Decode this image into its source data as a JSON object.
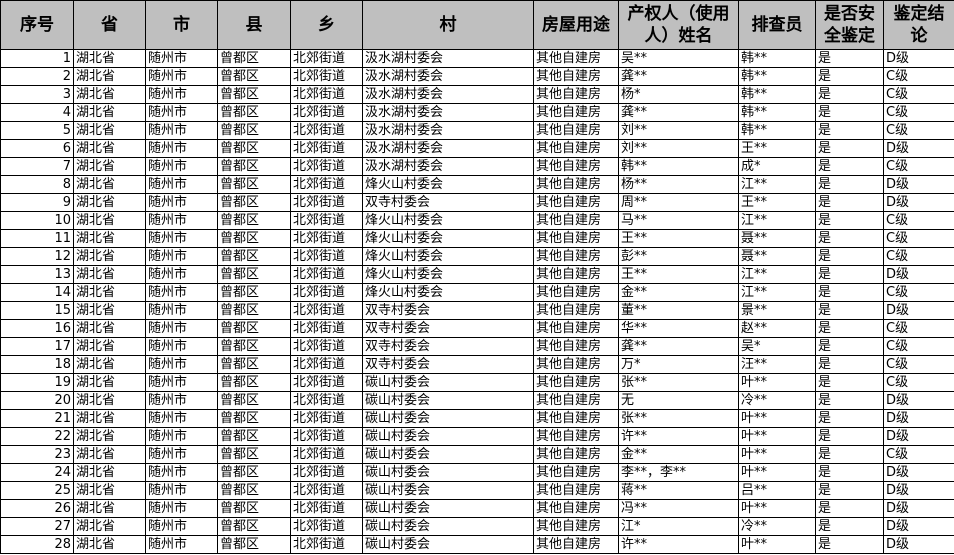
{
  "headers": [
    "序号",
    "省",
    "市",
    "县",
    "乡",
    "村",
    "房屋用途",
    "产权人（使用人）姓名",
    "排查员",
    "是否安全鉴定",
    "鉴定结论"
  ],
  "rows": [
    [
      "1",
      "湖北省",
      "随州市",
      "曾都区",
      "北郊街道",
      "汲水湖村委会",
      "其他自建房",
      "吴**",
      "韩**",
      "是",
      "D级"
    ],
    [
      "2",
      "湖北省",
      "随州市",
      "曾都区",
      "北郊街道",
      "汲水湖村委会",
      "其他自建房",
      "龚**",
      "韩**",
      "是",
      "C级"
    ],
    [
      "3",
      "湖北省",
      "随州市",
      "曾都区",
      "北郊街道",
      "汲水湖村委会",
      "其他自建房",
      "杨*",
      "韩**",
      "是",
      "C级"
    ],
    [
      "4",
      "湖北省",
      "随州市",
      "曾都区",
      "北郊街道",
      "汲水湖村委会",
      "其他自建房",
      "龚**",
      "韩**",
      "是",
      "C级"
    ],
    [
      "5",
      "湖北省",
      "随州市",
      "曾都区",
      "北郊街道",
      "汲水湖村委会",
      "其他自建房",
      "刘**",
      "韩**",
      "是",
      "C级"
    ],
    [
      "6",
      "湖北省",
      "随州市",
      "曾都区",
      "北郊街道",
      "汲水湖村委会",
      "其他自建房",
      "刘**",
      "王**",
      "是",
      "D级"
    ],
    [
      "7",
      "湖北省",
      "随州市",
      "曾都区",
      "北郊街道",
      "汲水湖村委会",
      "其他自建房",
      "韩**",
      "成*",
      "是",
      "C级"
    ],
    [
      "8",
      "湖北省",
      "随州市",
      "曾都区",
      "北郊街道",
      "烽火山村委会",
      "其他自建房",
      "杨**",
      "江**",
      "是",
      "D级"
    ],
    [
      "9",
      "湖北省",
      "随州市",
      "曾都区",
      "北郊街道",
      "双寺村委会",
      "其他自建房",
      "周**",
      "王**",
      "是",
      "D级"
    ],
    [
      "10",
      "湖北省",
      "随州市",
      "曾都区",
      "北郊街道",
      "烽火山村委会",
      "其他自建房",
      "马**",
      "江**",
      "是",
      "C级"
    ],
    [
      "11",
      "湖北省",
      "随州市",
      "曾都区",
      "北郊街道",
      "烽火山村委会",
      "其他自建房",
      "王**",
      "聂**",
      "是",
      "C级"
    ],
    [
      "12",
      "湖北省",
      "随州市",
      "曾都区",
      "北郊街道",
      "烽火山村委会",
      "其他自建房",
      "彭**",
      "聂**",
      "是",
      "C级"
    ],
    [
      "13",
      "湖北省",
      "随州市",
      "曾都区",
      "北郊街道",
      "烽火山村委会",
      "其他自建房",
      "王**",
      "江**",
      "是",
      "D级"
    ],
    [
      "14",
      "湖北省",
      "随州市",
      "曾都区",
      "北郊街道",
      "烽火山村委会",
      "其他自建房",
      "金**",
      "江**",
      "是",
      "C级"
    ],
    [
      "15",
      "湖北省",
      "随州市",
      "曾都区",
      "北郊街道",
      "双寺村委会",
      "其他自建房",
      "董**",
      "景**",
      "是",
      "D级"
    ],
    [
      "16",
      "湖北省",
      "随州市",
      "曾都区",
      "北郊街道",
      "双寺村委会",
      "其他自建房",
      "华**",
      "赵**",
      "是",
      "C级"
    ],
    [
      "17",
      "湖北省",
      "随州市",
      "曾都区",
      "北郊街道",
      "双寺村委会",
      "其他自建房",
      "龚**",
      "吴*",
      "是",
      "C级"
    ],
    [
      "18",
      "湖北省",
      "随州市",
      "曾都区",
      "北郊街道",
      "双寺村委会",
      "其他自建房",
      "万*",
      "汪**",
      "是",
      "C级"
    ],
    [
      "19",
      "湖北省",
      "随州市",
      "曾都区",
      "北郊街道",
      "碳山村委会",
      "其他自建房",
      "张**",
      "叶**",
      "是",
      "C级"
    ],
    [
      "20",
      "湖北省",
      "随州市",
      "曾都区",
      "北郊街道",
      "碳山村委会",
      "其他自建房",
      "无",
      "冷**",
      "是",
      "D级"
    ],
    [
      "21",
      "湖北省",
      "随州市",
      "曾都区",
      "北郊街道",
      "碳山村委会",
      "其他自建房",
      "张**",
      "叶**",
      "是",
      "D级"
    ],
    [
      "22",
      "湖北省",
      "随州市",
      "曾都区",
      "北郊街道",
      "碳山村委会",
      "其他自建房",
      "许**",
      "叶**",
      "是",
      "D级"
    ],
    [
      "23",
      "湖北省",
      "随州市",
      "曾都区",
      "北郊街道",
      "碳山村委会",
      "其他自建房",
      "金**",
      "叶**",
      "是",
      "C级"
    ],
    [
      "24",
      "湖北省",
      "随州市",
      "曾都区",
      "北郊街道",
      "碳山村委会",
      "其他自建房",
      "李**，李**",
      "叶**",
      "是",
      "D级"
    ],
    [
      "25",
      "湖北省",
      "随州市",
      "曾都区",
      "北郊街道",
      "碳山村委会",
      "其他自建房",
      "蒋**",
      "吕**",
      "是",
      "D级"
    ],
    [
      "26",
      "湖北省",
      "随州市",
      "曾都区",
      "北郊街道",
      "碳山村委会",
      "其他自建房",
      "冯**",
      "叶**",
      "是",
      "D级"
    ],
    [
      "27",
      "湖北省",
      "随州市",
      "曾都区",
      "北郊街道",
      "碳山村委会",
      "其他自建房",
      "江*",
      "冷**",
      "是",
      "D级"
    ],
    [
      "28",
      "湖北省",
      "随州市",
      "曾都区",
      "北郊街道",
      "碳山村委会",
      "其他自建房",
      "许**",
      "叶**",
      "是",
      "D级"
    ]
  ]
}
